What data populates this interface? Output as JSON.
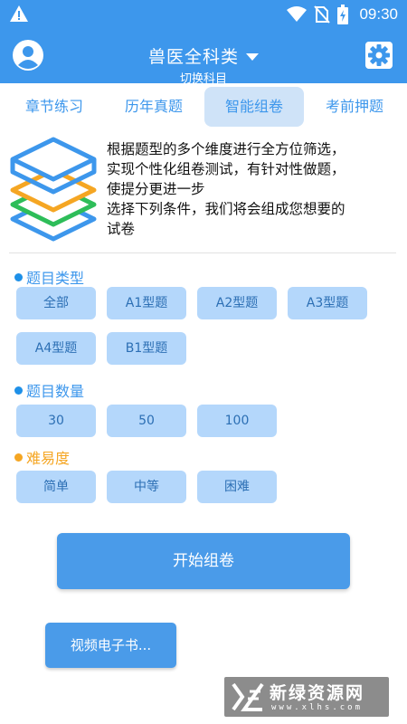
{
  "status_bar": {
    "time": "09:30",
    "icons": [
      "warning-icon",
      "wifi-icon",
      "no-sim-icon",
      "battery-icon"
    ]
  },
  "app_bar": {
    "title": "兽医全科类",
    "subtitle": "切换科目",
    "left_icon": "account-icon",
    "right_icon": "settings-icon"
  },
  "tabs": [
    {
      "label": "章节练习",
      "active": false
    },
    {
      "label": "历年真题",
      "active": false
    },
    {
      "label": "智能组卷",
      "active": true
    },
    {
      "label": "考前押题",
      "active": false
    }
  ],
  "intro": {
    "icon": "layers-icon",
    "lines": [
      "根据题型的多个维度进行全方位筛选，",
      "实现个性化组卷测试，有针对性做题，",
      "使提分更进一步",
      "选择下列条件，我们将会组成您想要的",
      "试卷"
    ]
  },
  "sections": {
    "type": {
      "title": "题目类型",
      "options": [
        "全部",
        "A1型题",
        "A2型题",
        "A3型题",
        "A4型题",
        "B1型题"
      ]
    },
    "count": {
      "title": "题目数量",
      "options": [
        "30",
        "50",
        "100"
      ]
    },
    "difficulty": {
      "title": "难易度",
      "options": [
        "简单",
        "中等",
        "困难"
      ]
    }
  },
  "buttons": {
    "start": "开始组卷",
    "video": "视频电子书..."
  },
  "watermark": {
    "text": "新绿资源网",
    "url": "www.xlhs.com"
  },
  "colors": {
    "primary": "#3d97ec",
    "chip_bg": "#b4d7fb",
    "chip_text": "#2c6fb4",
    "dot_blue": "#1e90e8",
    "dot_orange": "#f5a623",
    "difficulty_title": "#f5a623",
    "layer_blue": "#3d97ec",
    "layer_orange": "#f5a623",
    "layer_green": "#2ebd59"
  }
}
